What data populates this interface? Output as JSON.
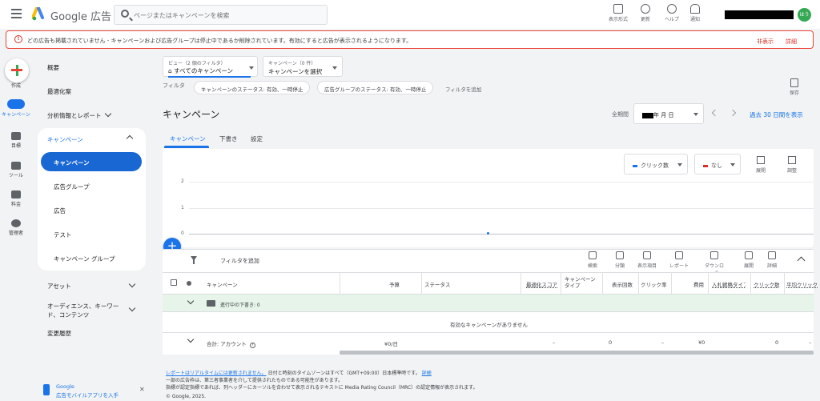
{
  "header": {
    "brand": "Google 広告",
    "search_placeholder": "ページまたはキャンペーンを検索",
    "tools": [
      {
        "label": "表示形式",
        "icon": "appearance-icon"
      },
      {
        "label": "更新",
        "icon": "refresh-icon"
      },
      {
        "label": "ヘルプ",
        "icon": "help-icon"
      },
      {
        "label": "通知",
        "icon": "bell-icon"
      }
    ],
    "avatar_text": "はう"
  },
  "alert": {
    "message": "どの広告も掲載されていません - キャンペーンおよび広告グループは停止中であるか削除されています。有効にすると広告が表示されるようになります。",
    "dismiss": "非表示",
    "details": "詳細"
  },
  "rail": [
    {
      "label": "作成",
      "icon": "plus-icon"
    },
    {
      "label": "キャンペーン",
      "icon": "megaphone-icon"
    },
    {
      "label": "目標",
      "icon": "trophy-icon"
    },
    {
      "label": "ツール",
      "icon": "wrench-icon"
    },
    {
      "label": "料金",
      "icon": "card-icon"
    },
    {
      "label": "管理者",
      "icon": "gear-icon"
    }
  ],
  "nav": {
    "overview": "概要",
    "recommendations": "最適化案",
    "insights": "分析情報とレポート",
    "campaigns_header": "キャンペーン",
    "campaigns_items": [
      "キャンペーン",
      "広告グループ",
      "広告",
      "テスト",
      "キャンペーン グループ"
    ],
    "assets": "アセット",
    "audiences": "オーディエンス、キーワード、コンテンツ",
    "change_history": "変更履歴",
    "app_promo_line1": "Google",
    "app_promo_line2": "広告モバイルアプリを入手"
  },
  "view": {
    "label": "ビュー（2 個のフィルタ）",
    "value": "すべてのキャンペーン",
    "campaign_label": "キャンペーン（0 件）",
    "campaign_value": "キャンペーンを選択"
  },
  "filters": {
    "label": "フィルタ",
    "chips": [
      "キャンペーンのステータス: 有効、一時停止",
      "広告グループのステータス: 有効、一時停止"
    ],
    "add": "フィルタを追加",
    "save": "保存"
  },
  "page": {
    "title": "キャンペーン",
    "period_label": "全期間",
    "date_text": "年 月 日",
    "last30": "過去 30 日間を表示"
  },
  "tabs": [
    "キャンペーン",
    "下書き",
    "設定"
  ],
  "chart": {
    "metric1": "クリック数",
    "metric1_color": "#1a73e8",
    "metric2": "なし",
    "metric2_color": "#d93025",
    "tool_expand": "展開",
    "tool_adjust": "調整"
  },
  "chart_data": {
    "type": "line",
    "y_ticks": [
      "2",
      "1",
      "0"
    ],
    "ylim": [
      0,
      2
    ],
    "series": [
      {
        "name": "クリック数",
        "values": [
          0
        ]
      }
    ]
  },
  "table": {
    "add_filter": "フィルタを追加",
    "tools": [
      "検索",
      "分類",
      "表示項目",
      "レポート",
      "ダウンロード",
      "展開",
      "詳細"
    ],
    "columns": [
      "キャンペーン",
      "予算",
      "ステータス",
      "最適化スコア",
      "キャンペーン タイプ",
      "表示回数",
      "クリック率",
      "費用",
      "入札戦略タイプ",
      "クリック数",
      "平均クリック"
    ],
    "draft_row": "進行中の下書き: 0",
    "empty_message": "有効なキャンペーンがありません",
    "total_label": "合計: アカウント",
    "total_budget": "¥0/日",
    "total_values": [
      "–",
      "0",
      "–",
      "¥0",
      "0",
      "–"
    ]
  },
  "footer": {
    "link": "レポートはリアルタイムには更新されません。",
    "line1": "日付と時刻のタイムゾーンはすべて（GMT+09:00）日本標準時です。",
    "details": "詳細",
    "line2": "一部の広告枠は、第三者事業者を介して提供されたものである可能性があります。",
    "line3": "指標が認定指標であれば、列ヘッダーにカーソルを合わせて表示されるテキストに Media Rating Council（MRC）の認定情報が表示されます。",
    "copyright": "© Google, 2025."
  }
}
